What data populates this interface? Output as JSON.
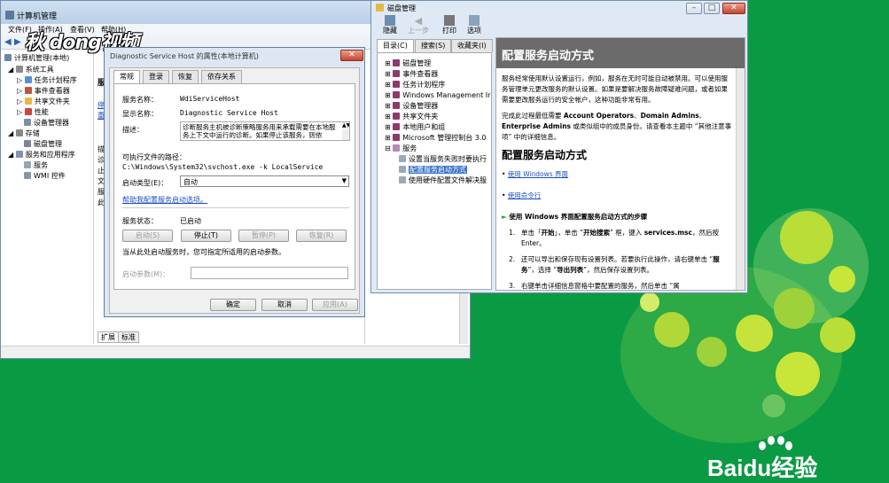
{
  "computer_mgmt": {
    "title": "计算机管理",
    "menu": [
      "文件(F)",
      "操作(A)",
      "查看(V)",
      "帮助(H)"
    ],
    "tree_root": "计算机管理(本地)",
    "tree": [
      "系统工具",
      "任务计划程序",
      "事件查看器",
      "共享文件夹",
      "性能",
      "设备管理器",
      "存储",
      "磁盘管理",
      "服务和应用程序",
      "服务",
      "WMI 控件"
    ],
    "mid_header": "服",
    "mid_link_fragments": [
      "停",
      "重"
    ],
    "mid_desc_fragments": [
      "描",
      "诊",
      "止",
      "文",
      "服",
      "此"
    ],
    "bottom_tabs": [
      "扩展",
      "标准"
    ]
  },
  "watermark": {
    "text": "秋 dong视频"
  },
  "props": {
    "title": "Diagnostic Service Host 的属性(本地计算机)",
    "tabs": [
      "常规",
      "登录",
      "恢复",
      "依存关系"
    ],
    "service_name_label": "服务名称：",
    "service_name": "WdiServiceHost",
    "display_name_label": "显示名称：",
    "display_name": "Diagnostic Service Host",
    "desc_label": "描述：",
    "description": "诊断服务主机被诊断策略服务用来承载需要在本地服务上下文中运行的诊断。如果停止该服务，则依",
    "path_label": "可执行文件的路径：",
    "path": "C:\\Windows\\System32\\svchost.exe -k LocalService",
    "startup_type_label": "启动类型(E)：",
    "startup_type": "自动",
    "help_link": "帮助我配置服务启动选项。",
    "status_label": "服务状态：",
    "status": "已启动",
    "buttons": {
      "start": "启动(S)",
      "stop": "停止(T)",
      "pause": "暂停(P)",
      "resume": "恢复(R)"
    },
    "hint": "当从此处启动服务时，您可指定所适用的启动参数。",
    "params_label": "启动参数(M)：",
    "params_value": "",
    "ok": "确定",
    "cancel": "取消",
    "apply": "应用(A)"
  },
  "help": {
    "title": "磁盘管理",
    "toolbar": [
      {
        "icon": "hide-icon",
        "label": "隐藏"
      },
      {
        "icon": "back-icon",
        "label": "上一步"
      },
      {
        "icon": "print-icon",
        "label": "打印"
      },
      {
        "icon": "options-icon",
        "label": "选项"
      }
    ],
    "nav_tabs": [
      "目录(C)",
      "搜索(S)",
      "收藏夹(I)"
    ],
    "toc": [
      "磁盘管理",
      "事件查看器",
      "任务计划程序",
      "Windows Management Ir",
      "设备管理器",
      "共享文件夹",
      "本地用户和组",
      "Microsoft 管理控制台 3.0",
      "服务",
      "设置当服务失败时要执行",
      "配置服务启动方式",
      "使用硬件配置文件解决服"
    ],
    "heading": "配置服务启动方式",
    "para1": "服务经常使用默认设置运行，例如，服务在无时可能自动被禁用。可以使用服务管理单元更改服务的默认设置。如果是要解决服务故障疑难问题，或者如果需要更改服务运行的安全帐户，这种功能非常有用。",
    "para2_a": "完成此过程最低需要 ",
    "para2_b": "Account Operators",
    "para2_c": "、",
    "para2_d": "Domain Admins",
    "para2_e": "、",
    "para2_f": "Enterprise Admins",
    "para2_g": " 或类似组中的成员身份。请查看本主题中 “其他注意事项” 中的详细信息。",
    "subheading": "配置服务启动方式",
    "link1": "使用 Windows 界面",
    "link2": "使用命令行",
    "steps_title": "使用 Windows 界面配置服务启动方式的步骤",
    "step1_a": "单击「",
    "step1_b": "开始",
    "step1_c": "」，单击 “",
    "step1_d": "开始搜索",
    "step1_e": "” 框，键入 ",
    "step1_f": "services.msc",
    "step1_g": "，然后按 Enter。",
    "step2_a": "还可以导出和保存现有设置列表。若要执行此操作，请右键单击 “",
    "step2_b": "服务",
    "step2_c": "”，选择 “",
    "step2_d": "导出列表",
    "step2_e": "”，然后保存设置列表。",
    "step3": "右键单击详细信息窗格中要配置的服务，然后单击 “属"
  },
  "brand": {
    "logo_text": "Baidu经验"
  },
  "colors": {
    "background": "#0b9a44",
    "help_header": "#6b6b6b",
    "link": "#1a4fc4",
    "deco_green": "#c5e33c"
  }
}
